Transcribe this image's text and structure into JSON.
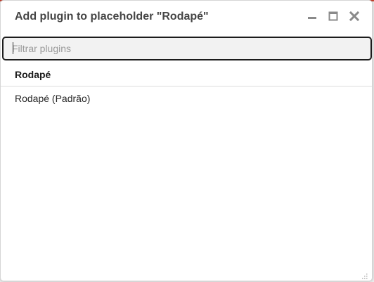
{
  "dialog": {
    "title": "Add plugin to placeholder \"Rodapé\"",
    "controls": {
      "minimize_icon": "minimize-icon",
      "maximize_icon": "maximize-icon",
      "close_icon": "close-icon"
    }
  },
  "filter": {
    "placeholder": "Filtrar plugins",
    "value": ""
  },
  "sections": [
    {
      "title": "Rodapé",
      "items": [
        {
          "label": "Rodapé (Padrão)"
        }
      ]
    }
  ],
  "colors": {
    "accent": "#c8412f",
    "title_text": "#454545",
    "focus_border": "#1c1c1c"
  }
}
